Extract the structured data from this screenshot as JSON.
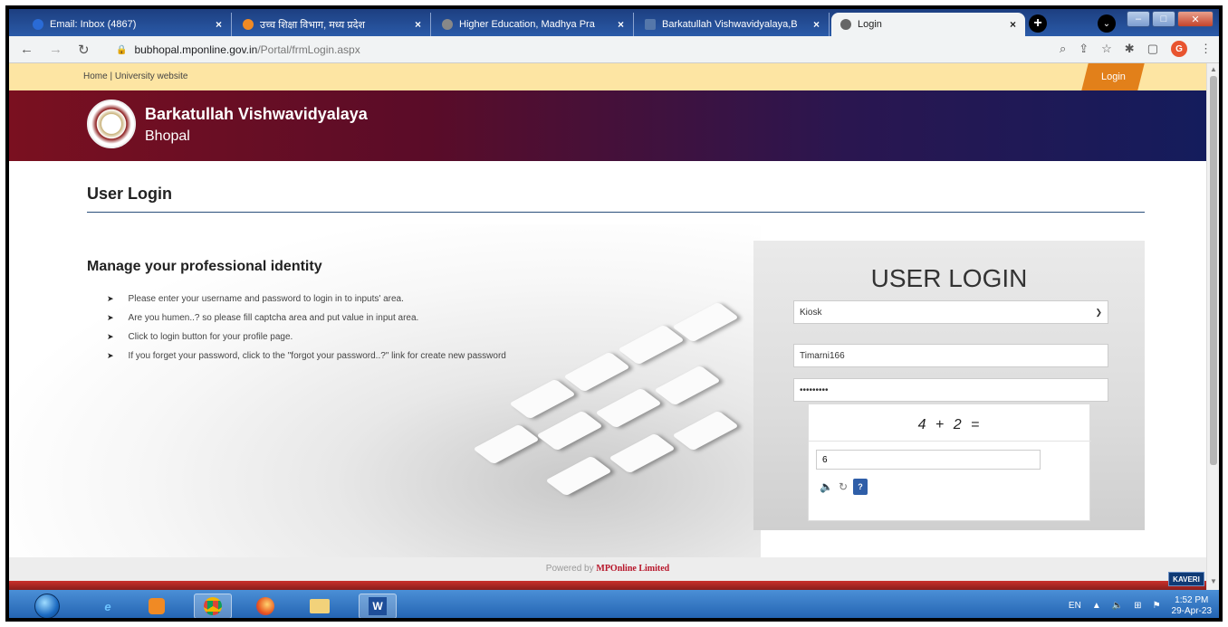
{
  "browser": {
    "tabs": [
      {
        "title": "Email: Inbox (4867)",
        "close": "×",
        "favicon_color": "#2a6bd6",
        "active": false
      },
      {
        "title": "उच्च शिक्षा विभाग, मध्य प्रदेश",
        "close": "×",
        "favicon_color": "#f08a24",
        "active": false
      },
      {
        "title": "Higher Education, Madhya Pra",
        "close": "×",
        "favicon_color": "#888888",
        "active": false
      },
      {
        "title": "Barkatullah Vishwavidyalaya,B",
        "close": "×",
        "favicon_color": "#5577aa",
        "active": false
      },
      {
        "title": "Login",
        "close": "×",
        "favicon_color": "#666666",
        "active": true
      }
    ],
    "new_tab": "+",
    "url_host": "bubhopal.mponline.gov.in",
    "url_path": "/Portal/frmLogin.aspx",
    "profile_initial": "G"
  },
  "page": {
    "topnav_links": "Home | University website",
    "login_button": "Login",
    "university_name": "Barkatullah Vishwavidyalaya",
    "university_city": "Bhopal",
    "section_title": "User Login",
    "manage_title": "Manage your professional identity",
    "bullets": [
      "Please enter your username and password to login in to inputs' area.",
      "Are you humen..? so please fill captcha area and put value in input area.",
      "Click to login button for your profile page.",
      "If you forget your password, click to the \"forgot your password..?\" link for create new password"
    ],
    "login_panel": {
      "title": "USER LOGIN",
      "role_selected": "Kiosk",
      "username": "Timarni166",
      "password_masked": "•••••••••",
      "captcha_question": "4 + 2 =",
      "captcha_answer": "6",
      "help_label": "?"
    },
    "footer_prefix": "Powered by",
    "footer_brand": "MPOnline Limited"
  },
  "taskbar": {
    "language": "EN",
    "time": "1:52 PM",
    "date": "29-Apr-23",
    "user_badge": "KAVERI"
  }
}
